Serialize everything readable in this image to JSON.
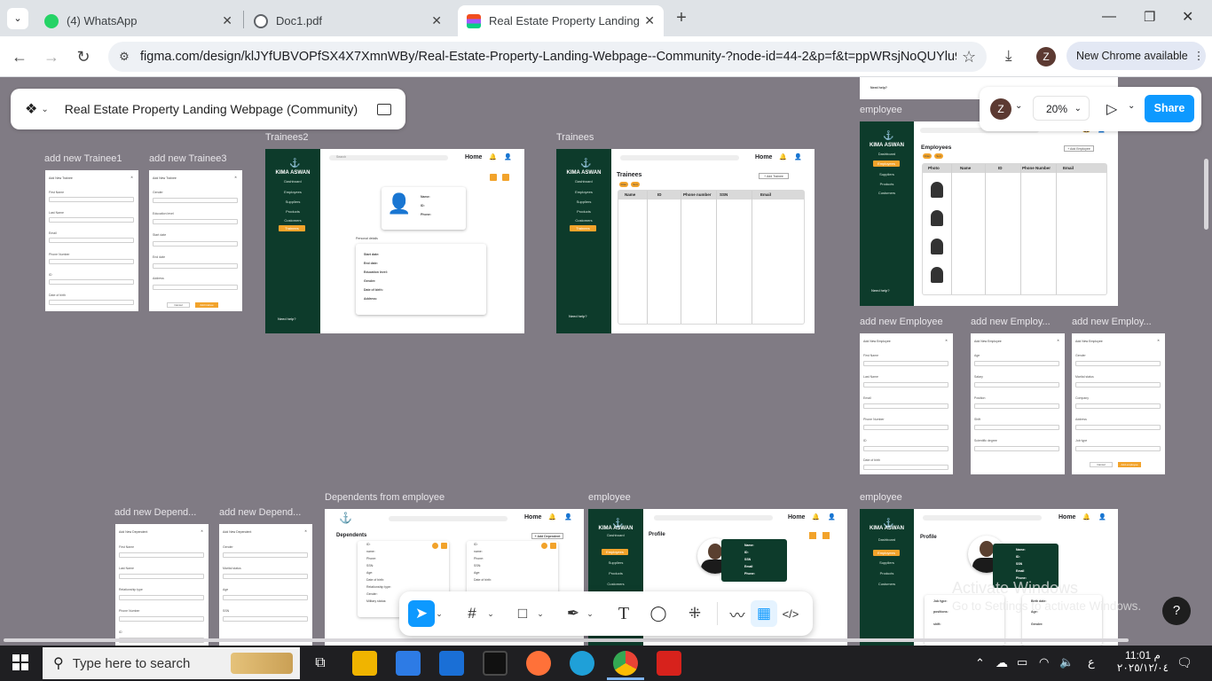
{
  "browser": {
    "tabs": [
      {
        "label": "(4) WhatsApp",
        "icon": "whatsapp-icon",
        "active": false
      },
      {
        "label": "Doc1.pdf",
        "icon": "globe-icon",
        "active": false
      },
      {
        "label": "Real Estate Property Landing W",
        "icon": "figma-icon",
        "active": true
      }
    ],
    "new_tab": "+",
    "url": "figma.com/design/klJYfUBVOPfSX4X7XmnWBy/Real-Estate-Property-Landing-Webpage--Community-?node-id=44-2&p=f&t=ppWRsjNoQUYlu9Id-0",
    "profile_initial": "Z",
    "update_label": "New Chrome available"
  },
  "figma": {
    "file_title": "Real Estate Property Landing Webpage (Community)",
    "avatar_initial": "Z",
    "zoom": "20%",
    "share_label": "Share",
    "help": "?"
  },
  "frames": {
    "add_trainee1": {
      "label": "add new Trainee1",
      "title": "Add New Trainee",
      "fields": [
        "First Name",
        "Last Name",
        "Email",
        "Phone Number",
        "ID",
        "Date of birth"
      ]
    },
    "add_trainee3": {
      "label": "add new Trainee3",
      "title": "Add New Trainee",
      "fields": [
        "Gender",
        "Education level",
        "Start date",
        "End date",
        "Address"
      ],
      "cancel": "Cancel",
      "submit": "Add trainee"
    },
    "trainees2": {
      "label": "Trainees2",
      "brand": "KIMA ASWAN",
      "nav": [
        "Dashboard",
        "Employees",
        "Suppliers",
        "Products",
        "Customers",
        "Trainees"
      ],
      "home": "Home",
      "search": "Search",
      "profile_fields": [
        "Name:",
        "ID:",
        "Phone:"
      ],
      "section": "Personal details",
      "details": [
        "Start date:",
        "End date:",
        "Education level:",
        "Gender:",
        "Date of birth:",
        "Address:"
      ],
      "help": "Need help?"
    },
    "trainees": {
      "label": "Trainees",
      "brand": "KIMA ASWAN",
      "nav": [
        "Dashboard",
        "Employees",
        "Suppliers",
        "Products",
        "Customers",
        "Trainees"
      ],
      "home": "Home",
      "title": "Trainees",
      "add": "+ Add Trainee",
      "chips": [
        "Filter",
        "Sort"
      ],
      "columns": [
        "Name",
        "ID",
        "Phone number",
        "SSN",
        "Email"
      ],
      "help": "Need help?"
    },
    "employee_top": {
      "label": "employee",
      "brand": "KIMA ASWAN",
      "nav": [
        "Dashboard",
        "Employees",
        "Suppliers",
        "Products",
        "Customers"
      ],
      "home": "Home",
      "title": "Employees",
      "add": "+ Add Employee",
      "chips": [
        "Filter",
        "Sort"
      ],
      "columns": [
        "Photo",
        "Name",
        "ID",
        "Phone Number",
        "Email"
      ],
      "help": "Need help?"
    },
    "top_snippet": {
      "help": "Need help?"
    },
    "add_employee": [
      {
        "label": "add new Employee",
        "title": "Add New Employee",
        "fields": [
          "First Name",
          "Last Name",
          "Email",
          "Phone Number",
          "ID",
          "Date of birth"
        ]
      },
      {
        "label": "add new Employ...",
        "title": "Add New Employee",
        "fields": [
          "Age",
          "Salary",
          "Position",
          "Shift",
          "Scientific degree"
        ]
      },
      {
        "label": "add new Employ...",
        "title": "Add New Employee",
        "fields": [
          "Gender",
          "Marital status",
          "Company",
          "Address",
          "Job type"
        ],
        "cancel": "Cancel",
        "submit": "Add employee"
      }
    ],
    "add_dependent": [
      {
        "label": "add new Depend...",
        "title": "Add New Dependent",
        "fields": [
          "First Name",
          "Last Name",
          "Relationship type",
          "Phone Number",
          "ID"
        ]
      },
      {
        "label": "add new Depend...",
        "title": "Add New Dependent",
        "fields": [
          "Gender",
          "Marital status",
          "Age",
          "SSN"
        ]
      }
    ],
    "dependents": {
      "label": "Dependents from employee",
      "home": "Home",
      "title": "Dependents",
      "add": "+ Add Dependent",
      "rows": [
        "ID:",
        "name:",
        "Phone:",
        "SSN:",
        "Age:",
        "Date of birth:",
        "Relationship type:",
        "Gender:",
        "Military status:"
      ]
    },
    "employee_profile1": {
      "label": "employee",
      "brand": "KIMA ASWAN",
      "nav": [
        "Dashboard",
        "Employees",
        "Suppliers",
        "Products",
        "Customers"
      ],
      "home": "Home",
      "title": "Profile",
      "fields": [
        "Name:",
        "ID:",
        "SSN",
        "Email",
        "Phone:"
      ]
    },
    "employee_profile2": {
      "label": "employee",
      "brand": "KIMA ASWAN",
      "nav": [
        "Dashboard",
        "Employees",
        "Suppliers",
        "Products",
        "Customers"
      ],
      "home": "Home",
      "title": "Profile",
      "fields": [
        "Name:",
        "ID:",
        "SSN",
        "Email",
        "Phone:"
      ],
      "extra": [
        "Job type:",
        "positions:",
        "shift:",
        "Birth date:",
        "Age:",
        "Gender:"
      ]
    }
  },
  "watermark": {
    "line1": "Activate Windows",
    "line2": "Go to Settings to activate Windows."
  },
  "taskbar": {
    "search_placeholder": "Type here to search",
    "time": "11:01",
    "ampm": "م",
    "date": "٢٠٢٥/١٢/٠٤",
    "lang": "ع"
  },
  "colors": {
    "sidebar": "#0d3b2b",
    "accent": "#f2a32b",
    "figma_blue": "#0d99ff",
    "canvas": "#807b84"
  }
}
